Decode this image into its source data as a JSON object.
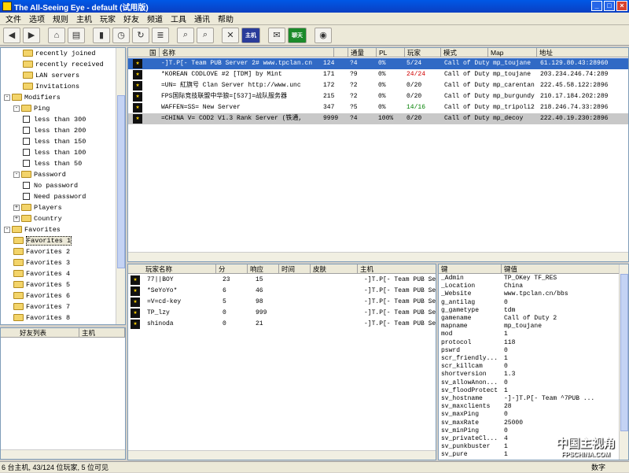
{
  "window": {
    "title": "The All-Seeing Eye - default (试用版)"
  },
  "menu": [
    "文件",
    "选项",
    "规则",
    "主机",
    "玩家",
    "好友",
    "频道",
    "工具",
    "通讯",
    "帮助"
  ],
  "toolbar": {
    "friends_label": "聊天",
    "host_label": "主机"
  },
  "tree": [
    {
      "label": "recently joined",
      "type": "folder",
      "level": 2
    },
    {
      "label": "recently received",
      "type": "folder",
      "level": 2
    },
    {
      "label": "LAN servers",
      "type": "folder",
      "level": 2
    },
    {
      "label": "Invitations",
      "type": "folder",
      "level": 2
    },
    {
      "label": "Modifiers",
      "type": "folder",
      "level": 0,
      "exp": "-"
    },
    {
      "label": "Ping",
      "type": "folder",
      "level": 1,
      "exp": "-"
    },
    {
      "label": "less than 300",
      "type": "check",
      "level": 2
    },
    {
      "label": "less than 200",
      "type": "check",
      "level": 2
    },
    {
      "label": "less than 150",
      "type": "check",
      "level": 2
    },
    {
      "label": "less than 100",
      "type": "check",
      "level": 2
    },
    {
      "label": "less than 50",
      "type": "check",
      "level": 2
    },
    {
      "label": "Password",
      "type": "folder",
      "level": 1,
      "exp": "-"
    },
    {
      "label": "No password",
      "type": "check",
      "level": 2
    },
    {
      "label": "Need password",
      "type": "check",
      "level": 2
    },
    {
      "label": "Players",
      "type": "folder",
      "level": 1,
      "exp": "+"
    },
    {
      "label": "Country",
      "type": "folder",
      "level": 1,
      "exp": "+"
    },
    {
      "label": "Favorites",
      "type": "folder",
      "level": 0,
      "exp": "-"
    },
    {
      "label": "Favorites 1",
      "type": "folder",
      "level": 1,
      "selected": true
    },
    {
      "label": "Favorites 2",
      "type": "folder",
      "level": 1
    },
    {
      "label": "Favorites 3",
      "type": "folder",
      "level": 1
    },
    {
      "label": "Favorites 4",
      "type": "folder",
      "level": 1
    },
    {
      "label": "Favorites 5",
      "type": "folder",
      "level": 1
    },
    {
      "label": "Favorites 6",
      "type": "folder",
      "level": 1
    },
    {
      "label": "Favorites 7",
      "type": "folder",
      "level": 1
    },
    {
      "label": "Favorites 8",
      "type": "folder",
      "level": 1
    }
  ],
  "friends": {
    "headers": [
      "好友列表",
      "主机"
    ]
  },
  "servers": {
    "headers": [
      "国",
      "名称",
      "",
      "通量",
      "PL",
      "玩家",
      "模式",
      "Map",
      "地址"
    ],
    "rows": [
      {
        "name": "-]T.P[- Team PUB Server 2# www.tpclan.cn",
        "ping": "124",
        "pl": "?4",
        "loss": "0%",
        "players": "5/24",
        "pcolor": "",
        "mode": "Call of Duty",
        "map": "mp_toujane",
        "addr": "61.129.80.43:28960",
        "selected": true
      },
      {
        "name": "*KOREAN CODLOVE #2 [TDM] by Mint",
        "ping": "171",
        "pl": "?9",
        "loss": "0%",
        "players": "24/24",
        "pcolor": "red",
        "mode": "Call of Duty",
        "map": "mp_toujane",
        "addr": "203.234.246.74:289"
      },
      {
        "name": "=UN= 紅旗号 Clan Server  http://www.unc",
        "ping": "172",
        "pl": "?2",
        "loss": "0%",
        "players": "0/20",
        "pcolor": "",
        "mode": "Call of Duty",
        "map": "mp_carentan",
        "addr": "222.45.58.122:2896"
      },
      {
        "name": "FPS国际竞技联盟中华狼=[537]=战队服务器",
        "ping": "215",
        "pl": "?2",
        "loss": "0%",
        "players": "0/20",
        "pcolor": "",
        "mode": "Call of Duty",
        "map": "mp_burgundy",
        "addr": "210.17.184.202:289"
      },
      {
        "name": "WAFFEN=SS= New Server",
        "ping": "347",
        "pl": "?5",
        "loss": "0%",
        "players": "14/16",
        "pcolor": "green",
        "mode": "Call of Duty",
        "map": "mp_tripoli2",
        "addr": "218.246.74.33:2896"
      },
      {
        "name": "=CHINA V= COD2 V1.3 Rank Server (铁通, ",
        "ping": "9999",
        "pl": "?4",
        "loss": "100%",
        "players": "0/20",
        "pcolor": "",
        "mode": "Call of Duty",
        "map": "mp_decoy",
        "addr": "222.40.19.230:2896",
        "grey": true
      }
    ]
  },
  "players": {
    "headers": [
      "玩家名称",
      "分",
      "响应",
      "时间",
      "皮肤",
      "主机"
    ],
    "rows": [
      {
        "name": "77||BOY",
        "score": "23",
        "ping": "15",
        "host": "-]T.P[- Team PUB Se"
      },
      {
        "name": "*SeYoYo*",
        "score": "6",
        "ping": "46",
        "host": "-]T.P[- Team PUB Se"
      },
      {
        "name": "=V=cd-key",
        "score": "5",
        "ping": "98",
        "host": "-]T.P[- Team PUB Se"
      },
      {
        "name": "TP_lzy",
        "score": "0",
        "ping": "999",
        "host": "-]T.P[- Team PUB Se"
      },
      {
        "name": "shinoda",
        "score": "0",
        "ping": "21",
        "host": "-]T.P[- Team PUB Se"
      }
    ]
  },
  "rules": {
    "headers": [
      "键",
      "键值"
    ],
    "rows": [
      [
        "_Admin",
        "TP_OKey TF_RES"
      ],
      [
        "_Location",
        "China"
      ],
      [
        "_Website",
        "www.tpclan.cn/bbs"
      ],
      [
        "g_antilag",
        "0"
      ],
      [
        "g_gametype",
        "tdm"
      ],
      [
        "gamename",
        "Call of Duty 2"
      ],
      [
        "mapname",
        "mp_toujane"
      ],
      [
        "mod",
        "1"
      ],
      [
        "protocol",
        "118"
      ],
      [
        "pswrd",
        "0"
      ],
      [
        "scr_friendly...",
        "1"
      ],
      [
        "scr_killcam",
        "0"
      ],
      [
        "shortversion",
        "1.3"
      ],
      [
        "sv_allowAnon...",
        "0"
      ],
      [
        "sv_floodProtect",
        "1"
      ],
      [
        "sv_hostname",
        "-]-]T.P[- Team ^7PUB ..."
      ],
      [
        "sv_maxclients",
        "28"
      ],
      [
        "sv_maxPing",
        "0"
      ],
      [
        "sv_maxRate",
        "25000"
      ],
      [
        "sv_minPing",
        "0"
      ],
      [
        "sv_privateCl...",
        "4"
      ],
      [
        "sv_punkbuster",
        "1"
      ],
      [
        "sv_pure",
        "1"
      ]
    ]
  },
  "status": {
    "text": "6 台主机, 43/124 位玩家, 5 位可见",
    "right": "数字"
  },
  "watermark": {
    "line1": "中国主视角",
    "line2": "FPSCHINA.COM"
  }
}
